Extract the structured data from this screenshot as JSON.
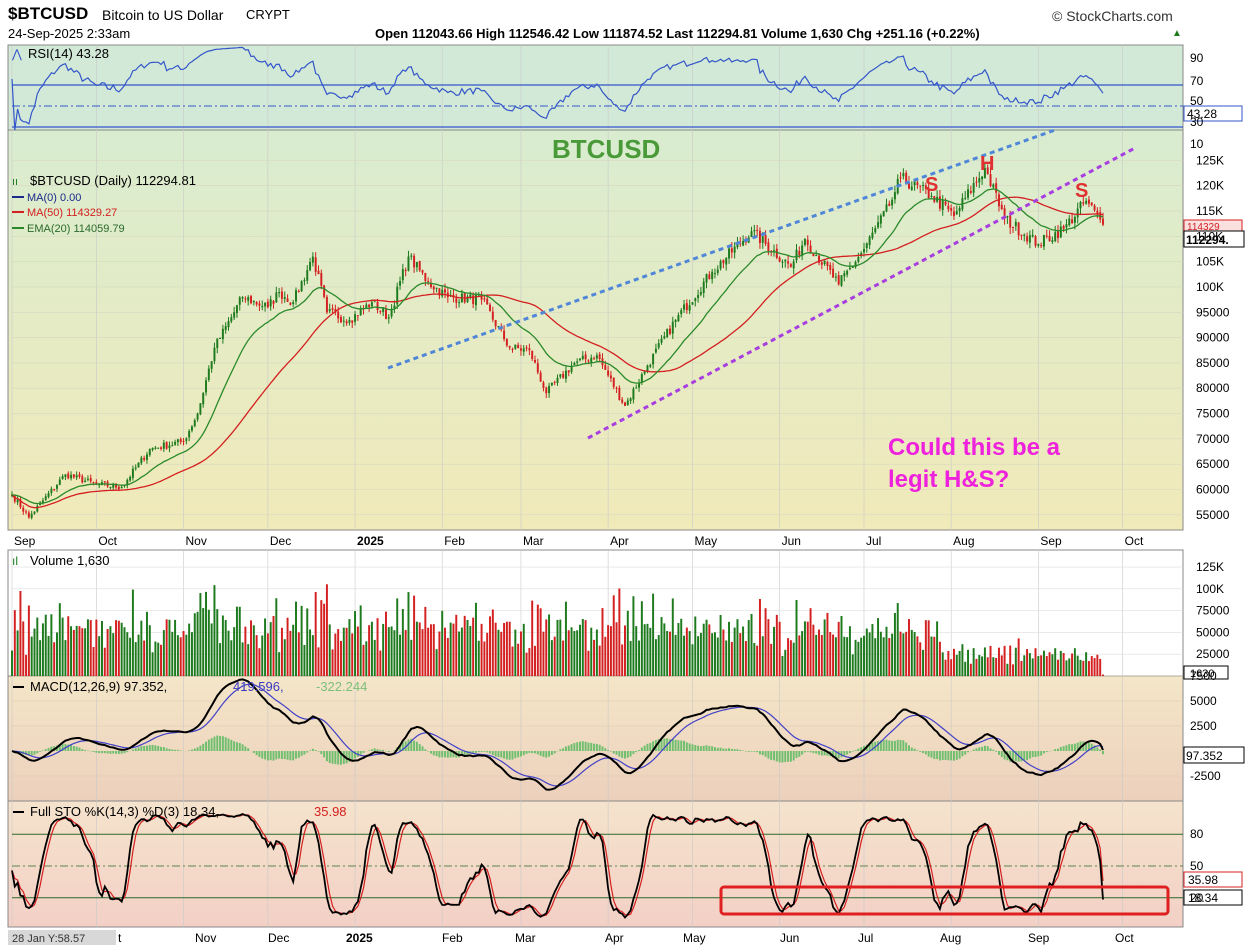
{
  "header": {
    "symbol": "$BTCUSD",
    "name": "Bitcoin to US Dollar",
    "exchange": "CRYPT",
    "date": "24-Sep-2025 2:33am",
    "brand": "StockCharts.com",
    "ohlc_text": "Open 112043.66 High 112546.42 Low 111874.52 Last 112294.81 Volume 1,630 Chg +251.16 (+0.22%)"
  },
  "colors": {
    "price_bg": "#eaeec2",
    "rsi_bg": "#d6ecd6",
    "macd_bg": "#efdcc2",
    "sto_bg": "#f6d8d0",
    "vol_bg": "#ffffff",
    "up": "#1d7a1d",
    "down": "#d42020",
    "ma50": "#d42020",
    "ema20": "#2a8a2a",
    "trend_blue": "#4f86d8",
    "trend_purple": "#a73ee0",
    "annotation_pink": "#ee22dd",
    "rsi_line": "#3356c8"
  },
  "annotations": {
    "chart_title": "BTCUSD",
    "left_shoulder": "S",
    "head": "H",
    "right_shoulder": "S",
    "question_line1": "Could this be a",
    "question_line2": "legit H&S?"
  },
  "panels": {
    "rsi": {
      "label": "RSI(14) 43.28",
      "last_tag": "43.28",
      "ticks": [
        "90",
        "70",
        "50",
        "30",
        "10"
      ]
    },
    "price": {
      "legend": [
        "$BTCUSD (Daily) 112294.81",
        "MA(0) 0.00",
        "MA(50) 114329.27",
        "EMA(20) 114059.79"
      ],
      "last_tag": "112294.",
      "ma50_tag": "114329",
      "ticks": [
        "125K",
        "120K",
        "115K",
        "110K",
        "105K",
        "100K",
        "95000",
        "90000",
        "85000",
        "80000",
        "75000",
        "70000",
        "65000",
        "60000",
        "55000"
      ]
    },
    "volume": {
      "label": "Volume 1,630",
      "last_tag": "1630",
      "ticks": [
        "125K",
        "100K",
        "75000",
        "50000",
        "25000"
      ]
    },
    "macd": {
      "label": "MACD(12,26,9) 97.352,",
      "signal_text": "419.596,",
      "hist_text": "-322.244",
      "last_tag": "97.352",
      "ticks": [
        "7500",
        "5000",
        "2500",
        "-2500"
      ]
    },
    "sto": {
      "label": "Full STO %K(14,3) %D(3) 18.34,",
      "d_text": "35.98",
      "k_tag": "18.34",
      "d_tag": "35.98",
      "ticks": [
        "80",
        "50",
        "20"
      ]
    }
  },
  "x_labels_top": [
    "Sep",
    "Oct",
    "Nov",
    "Dec",
    "2025",
    "Feb",
    "Mar",
    "Apr",
    "May",
    "Jun",
    "Jul",
    "Aug",
    "Sep",
    "Oct"
  ],
  "x_labels_bottom": [
    "t",
    "Nov",
    "Dec",
    "2025",
    "Feb",
    "Mar",
    "Apr",
    "May",
    "Jun",
    "Jul",
    "Aug",
    "Sep",
    "Oct"
  ],
  "crosshair_readout": "28 Jan Y:58.57",
  "chart_data": {
    "type": "candlestick",
    "series_anchors": [
      {
        "date": "2024-09-01",
        "close": 59000
      },
      {
        "date": "2024-09-07",
        "close": 54500
      },
      {
        "date": "2024-09-20",
        "close": 63000
      },
      {
        "date": "2024-10-01",
        "close": 61000
      },
      {
        "date": "2024-10-10",
        "close": 60500
      },
      {
        "date": "2024-10-20",
        "close": 68000
      },
      {
        "date": "2024-11-01",
        "close": 69500
      },
      {
        "date": "2024-11-06",
        "close": 75000
      },
      {
        "date": "2024-11-12",
        "close": 88000
      },
      {
        "date": "2024-11-22",
        "close": 98000
      },
      {
        "date": "2024-12-01",
        "close": 96000
      },
      {
        "date": "2024-12-05",
        "close": 99000
      },
      {
        "date": "2024-12-10",
        "close": 97000
      },
      {
        "date": "2024-12-17",
        "close": 106000
      },
      {
        "date": "2024-12-22",
        "close": 95000
      },
      {
        "date": "2024-12-30",
        "close": 93500
      },
      {
        "date": "2025-01-07",
        "close": 97000
      },
      {
        "date": "2025-01-13",
        "close": 94000
      },
      {
        "date": "2025-01-20",
        "close": 106000
      },
      {
        "date": "2025-01-27",
        "close": 101000
      },
      {
        "date": "2025-02-03",
        "close": 98000
      },
      {
        "date": "2025-02-15",
        "close": 97500
      },
      {
        "date": "2025-02-25",
        "close": 88000
      },
      {
        "date": "2025-03-04",
        "close": 87500
      },
      {
        "date": "2025-03-10",
        "close": 79000
      },
      {
        "date": "2025-03-20",
        "close": 85000
      },
      {
        "date": "2025-03-28",
        "close": 86500
      },
      {
        "date": "2025-04-07",
        "close": 76500
      },
      {
        "date": "2025-04-15",
        "close": 84500
      },
      {
        "date": "2025-04-25",
        "close": 93500
      },
      {
        "date": "2025-05-08",
        "close": 103000
      },
      {
        "date": "2025-05-22",
        "close": 111000
      },
      {
        "date": "2025-06-05",
        "close": 104000
      },
      {
        "date": "2025-06-10",
        "close": 109500
      },
      {
        "date": "2025-06-22",
        "close": 100500
      },
      {
        "date": "2025-07-01",
        "close": 107500
      },
      {
        "date": "2025-07-10",
        "close": 116000
      },
      {
        "date": "2025-07-14",
        "close": 121500
      },
      {
        "date": "2025-07-25",
        "close": 118000
      },
      {
        "date": "2025-08-02",
        "close": 114000
      },
      {
        "date": "2025-08-13",
        "close": 123500
      },
      {
        "date": "2025-08-20",
        "close": 113500
      },
      {
        "date": "2025-09-01",
        "close": 108500
      },
      {
        "date": "2025-09-10",
        "close": 111500
      },
      {
        "date": "2025-09-18",
        "close": 117000
      },
      {
        "date": "2025-09-24",
        "close": 112294.81
      }
    ],
    "ma50_last": 114329.27,
    "ema20_last": 114059.79,
    "rsi_last": 43.28,
    "macd_last": 97.352,
    "macd_signal_last": 419.596,
    "macd_hist_last": -322.244,
    "sto_k_last": 18.34,
    "sto_d_last": 35.98,
    "volume_last": 1630,
    "price_range": [
      52000,
      131000
    ],
    "rsi_range": [
      0,
      100
    ],
    "volume_range": [
      0,
      140000
    ],
    "macd_range": [
      -5000,
      7500
    ],
    "sto_range": [
      0,
      100
    ]
  }
}
